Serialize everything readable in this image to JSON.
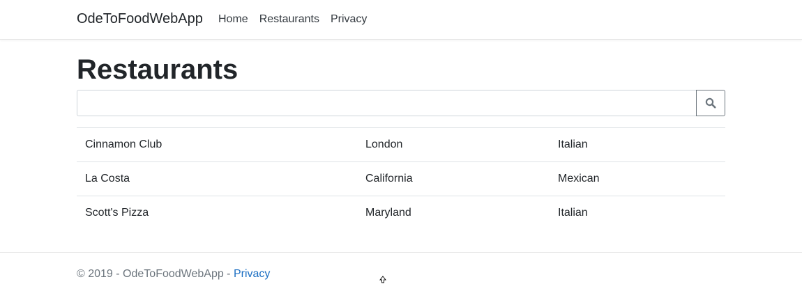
{
  "navbar": {
    "brand": "OdeToFoodWebApp",
    "links": [
      {
        "label": "Home"
      },
      {
        "label": "Restaurants"
      },
      {
        "label": "Privacy"
      }
    ]
  },
  "main": {
    "title": "Restaurants",
    "search": {
      "value": "",
      "placeholder": "",
      "button_icon": "search-icon"
    },
    "restaurants": [
      {
        "name": "Cinnamon Club",
        "location": "London",
        "cuisine": "Italian"
      },
      {
        "name": "La Costa",
        "location": "California",
        "cuisine": "Mexican"
      },
      {
        "name": "Scott's Pizza",
        "location": "Maryland",
        "cuisine": "Italian"
      }
    ]
  },
  "footer": {
    "text": "© 2019 - OdeToFoodWebApp - ",
    "link": "Privacy"
  },
  "colors": {
    "link": "#1b6ec2",
    "muted": "#6c757d",
    "border": "#dee2e6"
  }
}
